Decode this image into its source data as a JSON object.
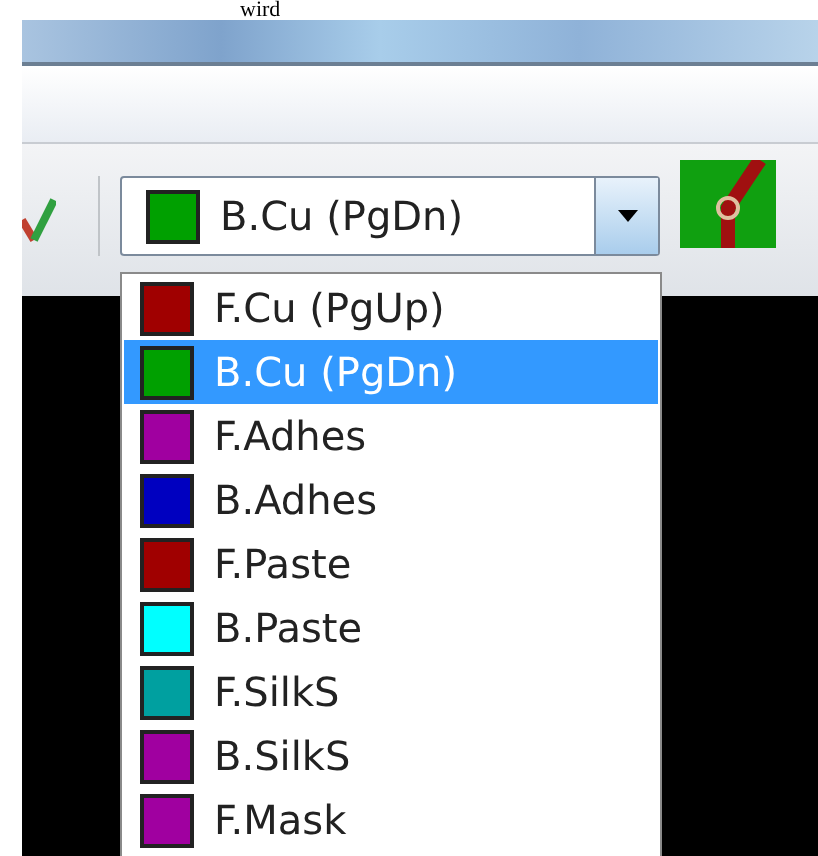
{
  "caption": "wird",
  "combo": {
    "value": "B.Cu (PgDn)",
    "color": "#00a000"
  },
  "layers": [
    {
      "label": "F.Cu (PgUp)",
      "color": "#a00000",
      "selected": false
    },
    {
      "label": "B.Cu (PgDn)",
      "color": "#00a000",
      "selected": true
    },
    {
      "label": "F.Adhes",
      "color": "#a000a0",
      "selected": false
    },
    {
      "label": "B.Adhes",
      "color": "#0000c0",
      "selected": false
    },
    {
      "label": "F.Paste",
      "color": "#a00000",
      "selected": false
    },
    {
      "label": "B.Paste",
      "color": "#00ffff",
      "selected": false
    },
    {
      "label": "F.SilkS",
      "color": "#00a0a0",
      "selected": false
    },
    {
      "label": "B.SilkS",
      "color": "#a000a0",
      "selected": false
    },
    {
      "label": "F.Mask",
      "color": "#a000a0",
      "selected": false
    }
  ]
}
